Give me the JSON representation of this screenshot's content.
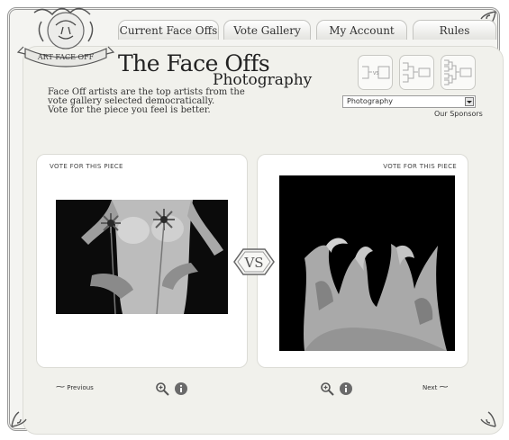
{
  "nav": {
    "tabs": [
      {
        "label": "Current Face Offs"
      },
      {
        "label": "Vote Gallery"
      },
      {
        "label": "My Account"
      },
      {
        "label": "Rules"
      }
    ]
  },
  "logo": {
    "text": "ART FACE OFF"
  },
  "header": {
    "title": "The Face Offs",
    "subtitle": "Photography",
    "intro_lines": [
      "Face Off artists are the top artists from the",
      "vote gallery selected democratically.",
      "Vote for the piece you feel is better."
    ]
  },
  "category_select": {
    "value": "Photography"
  },
  "sponsors_link": "Our Sponsors",
  "brackets": [
    {
      "icon": "bracket-2-icon",
      "label": "VS"
    },
    {
      "icon": "bracket-4-icon"
    },
    {
      "icon": "bracket-8-icon"
    }
  ],
  "left_entry": {
    "vote_label": "VOTE FOR THIS PIECE",
    "image_icon": "photo-flowers-torso"
  },
  "right_entry": {
    "vote_label": "VOTE FOR THIS PIECE",
    "image_icon": "photo-abstract-sculpture"
  },
  "versus_label": "VS",
  "footer": {
    "previous_label": "Previous",
    "next_label": "Next"
  },
  "icons": {
    "zoom": "zoom-in-icon",
    "info": "info-icon"
  },
  "colors": {
    "background": "#f4f4f1",
    "panel": "#ffffff",
    "text": "#222222",
    "border": "#9a9a9a"
  }
}
